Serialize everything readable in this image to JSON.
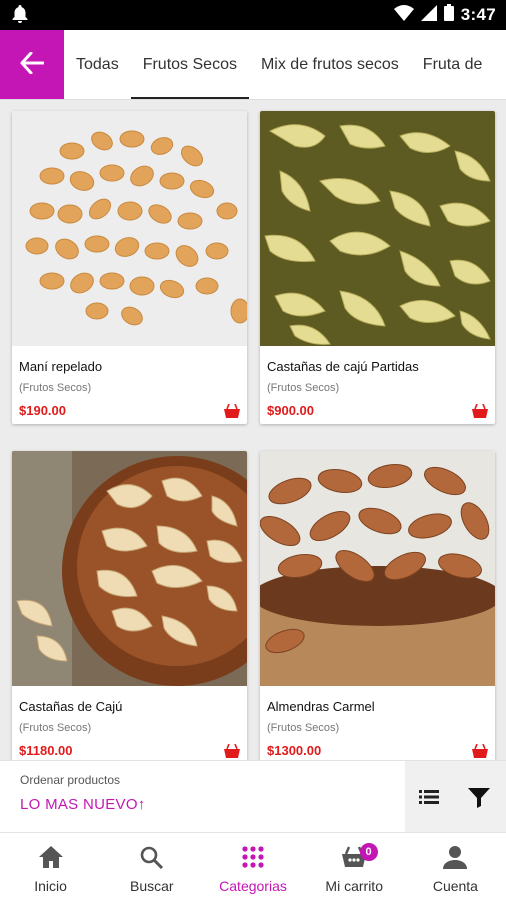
{
  "status_bar": {
    "time": "3:47"
  },
  "tabs": [
    {
      "label": "Todas"
    },
    {
      "label": "Frutos Secos"
    },
    {
      "label": "Mix de frutos secos"
    },
    {
      "label": "Fruta de"
    }
  ],
  "products": [
    {
      "name": "Maní repelado",
      "category": "(Frutos Secos)",
      "price": "$190.00"
    },
    {
      "name": "Castañas de cajú Partidas",
      "category": "(Frutos Secos)",
      "price": "$900.00"
    },
    {
      "name": "Castañas de Cajú",
      "category": "(Frutos Secos)",
      "price": "$1180.00"
    },
    {
      "name": "Almendras Carmel",
      "category": "(Frutos Secos)",
      "price": "$1300.00"
    }
  ],
  "sort": {
    "label": "Ordenar productos",
    "value": "LO MAS NUEVO↑"
  },
  "bottom_nav": [
    {
      "label": "Inicio"
    },
    {
      "label": "Buscar"
    },
    {
      "label": "Categorias"
    },
    {
      "label": "Mi carrito",
      "badge": "0"
    },
    {
      "label": "Cuenta"
    }
  ],
  "colors": {
    "accent": "#c316b4",
    "price": "#e11b1b"
  }
}
